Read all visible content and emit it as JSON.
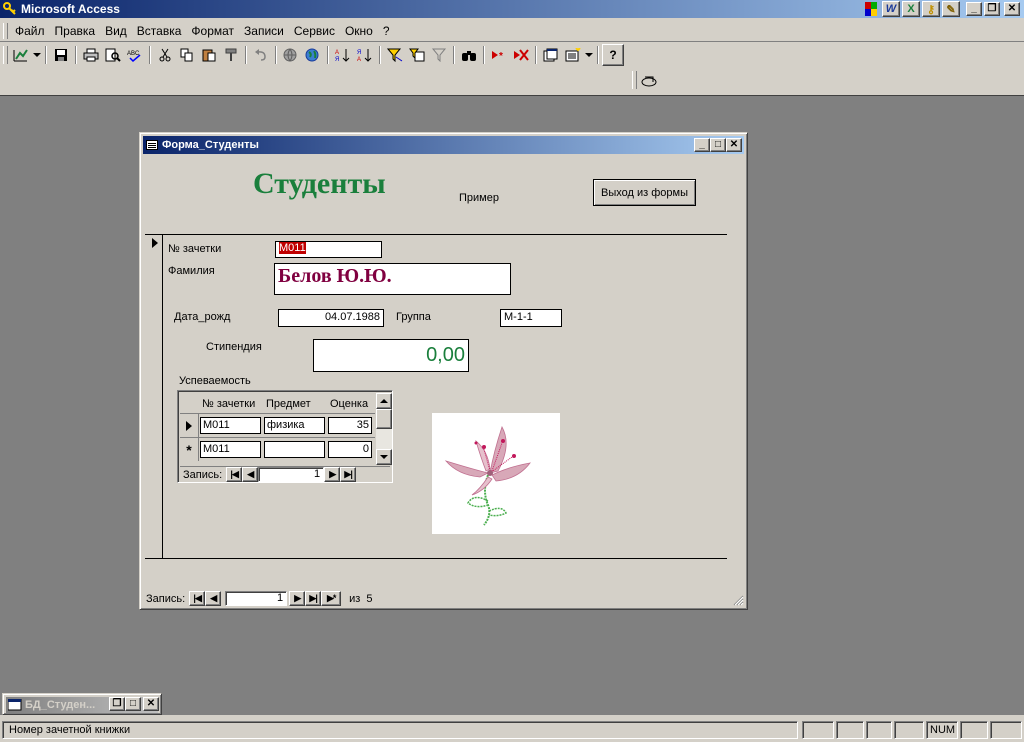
{
  "app": {
    "title": "Microsoft Access"
  },
  "menu": [
    "Файл",
    "Правка",
    "Вид",
    "Вставка",
    "Формат",
    "Записи",
    "Сервис",
    "Окно",
    "?"
  ],
  "form_window": {
    "title": "Форма_Студенты"
  },
  "form": {
    "title": "Студенты",
    "sample_label": "Пример",
    "exit_button": "Выход из формы",
    "fields": {
      "zachetka_label": "№ зачетки",
      "zachetka_value": "М011",
      "familiya_label": "Фамилия",
      "familiya_value": "Белов Ю.Ю.",
      "birth_label": "Дата_рожд",
      "birth_value": "04.07.1988",
      "group_label": "Группа",
      "group_value": "М-1-1",
      "stipendia_label": "Стипендия",
      "stipendia_value": "0,00"
    },
    "subform": {
      "label": "Успеваемость",
      "columns": [
        "№ зачетки",
        "Предмет",
        "Оценка"
      ],
      "rows": [
        {
          "selector": "current",
          "zachetka": "М011",
          "predmet": "физика",
          "ocenka": "35"
        },
        {
          "selector": "new",
          "zachetka": "М011",
          "predmet": "",
          "ocenka": "0"
        }
      ],
      "nav_label": "Запись:",
      "nav_value": "1"
    },
    "nav": {
      "label": "Запись:",
      "current": "1",
      "of_label": "из",
      "total": "5"
    }
  },
  "db_window": {
    "title": "БД_Студен..."
  },
  "status": {
    "text": "Номер зачетной книжки",
    "num": "NUM"
  },
  "colors": {
    "title_green": "#1a7f3c",
    "name_maroon": "#800040",
    "selection_red": "#c00000",
    "titlebar_dark": "#0a246a",
    "titlebar_light": "#a6caf0"
  }
}
